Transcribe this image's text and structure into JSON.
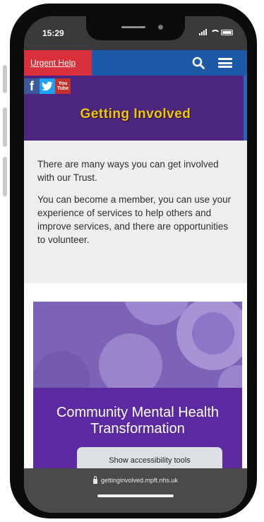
{
  "status_bar": {
    "time": "15:29"
  },
  "header": {
    "urgent_help": "Urgent Help"
  },
  "banner": {
    "social": [
      "f",
      "t",
      "You",
      "Tube"
    ],
    "title": "Getting Involved"
  },
  "intro": {
    "paragraphs": [
      "There are many ways you can get involved with our Trust.",
      "You can become a member, you can use your experience of services to help others and improve services, and there are opportunities to volunteer."
    ]
  },
  "card": {
    "title": "Community Mental Health Transformation"
  },
  "accessibility": {
    "label": "Show accessibility tools"
  },
  "browser": {
    "url": "gettinginvolved.mpft.nhs.uk"
  },
  "colors": {
    "header_blue": "#1c5aa8",
    "urgent_red": "#d9303b",
    "banner_purple": "#4b257f",
    "title_yellow": "#f2c600",
    "card_purple": "#5c2aa0"
  },
  "icons": [
    "search-icon",
    "menu-icon",
    "facebook-icon",
    "twitter-icon",
    "youtube-icon",
    "lock-icon",
    "signal-icon",
    "wifi-icon",
    "battery-icon"
  ]
}
